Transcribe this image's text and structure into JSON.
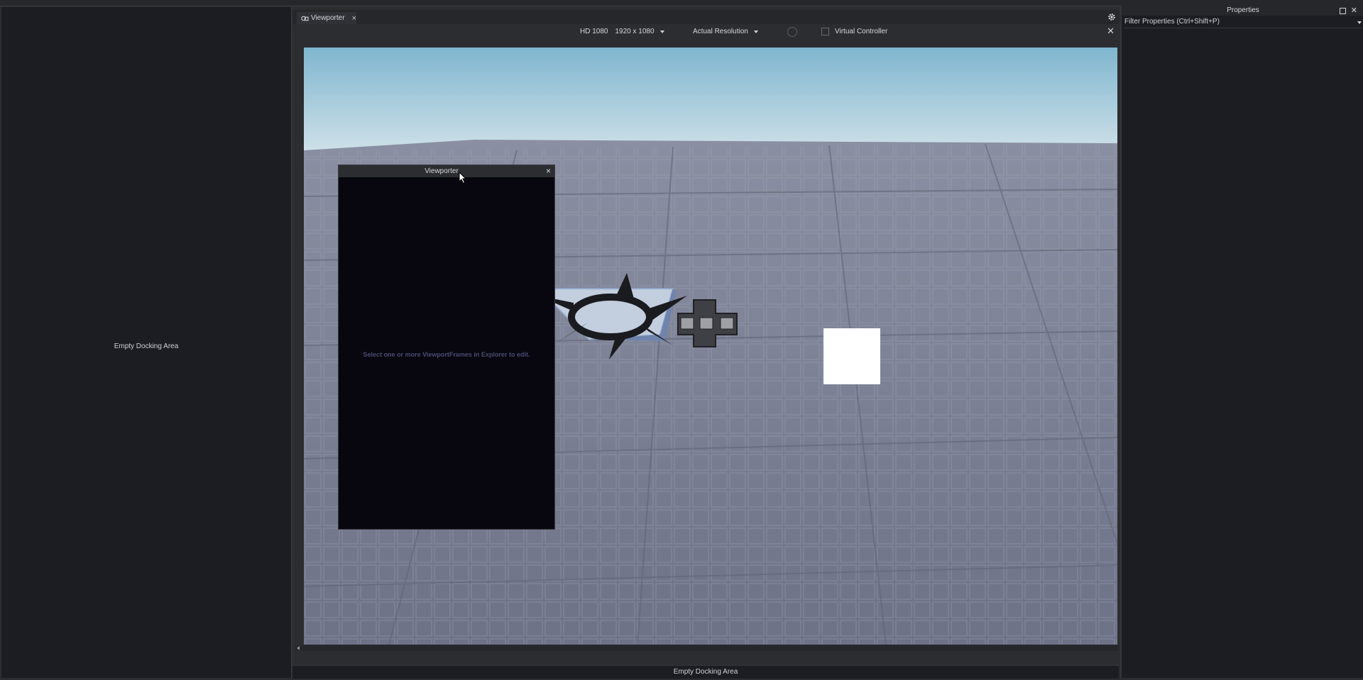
{
  "left_panel": {
    "label": "Empty Docking Area"
  },
  "center": {
    "tab": {
      "label": "Viewporter",
      "close": "×"
    },
    "toolbar": {
      "device": "HD 1080",
      "resolution": "1920 x 1080",
      "scale": "Actual Resolution",
      "virtual_controller": "Virtual Controller",
      "close": "✕"
    }
  },
  "viewporter_window": {
    "title": "Viewporter",
    "close": "×",
    "message": "Select one or more ViewportFrames in Explorer to edit."
  },
  "bottom_panel": {
    "label": "Empty Docking Area"
  },
  "right_panel": {
    "title": "Properties",
    "close": "✕",
    "filter_placeholder": "Filter Properties (Ctrl+Shift+P)"
  },
  "colors": {
    "panel_bg": "#1b1d22",
    "sky_top": "#7fb6cf",
    "floor": "#7c8196",
    "viewport_bg": "#08070f"
  },
  "icons": [
    "viewporter-tab-icon",
    "gear-icon",
    "close-icon",
    "cursor-icon",
    "dpad-icon"
  ]
}
